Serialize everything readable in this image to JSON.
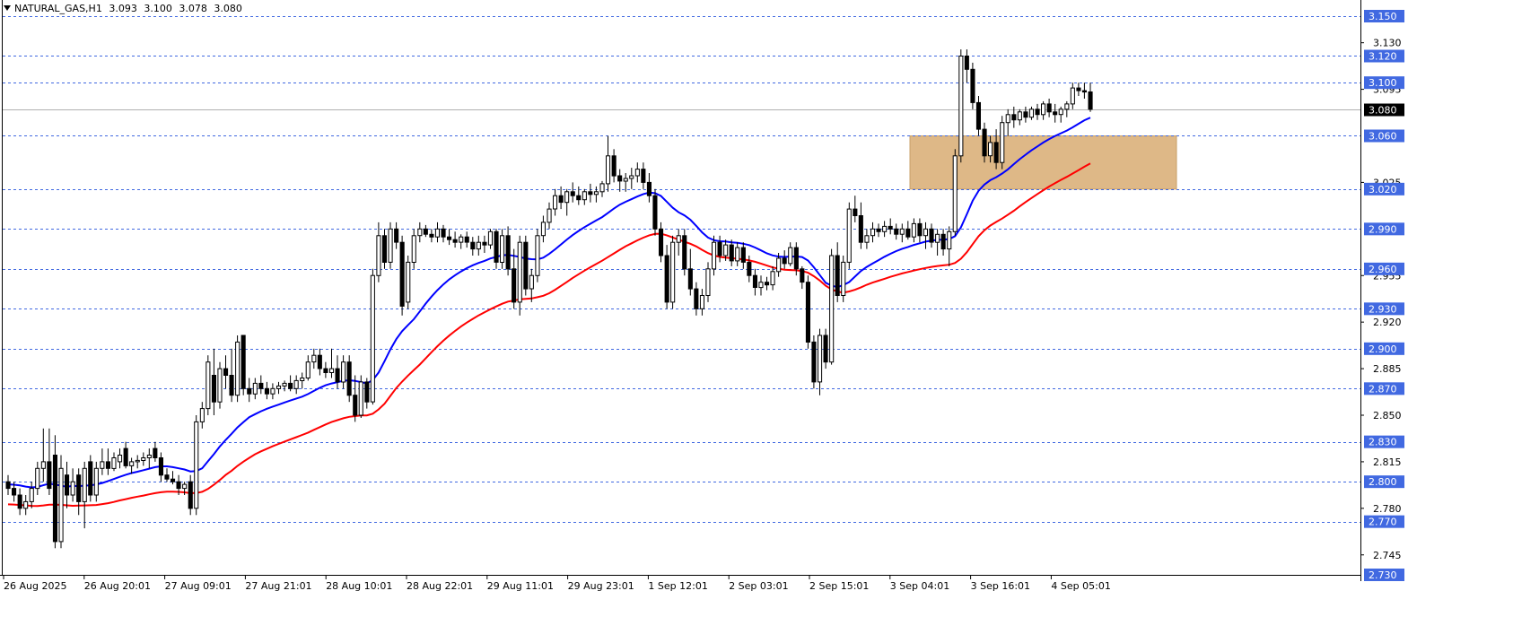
{
  "header": {
    "symbol": "NATURAL_GAS,H1",
    "open": "3.093",
    "high": "3.100",
    "low": "3.078",
    "close": "3.080"
  },
  "chart_data": {
    "type": "candlestick",
    "ylim": [
      2.73,
      3.165
    ],
    "grid": false,
    "price_ticks": [
      "3.130",
      "3.095",
      "3.025",
      "2.955",
      "2.920",
      "2.885",
      "2.850",
      "2.815",
      "2.780",
      "2.745"
    ],
    "level_lines": [
      "3.150",
      "3.120",
      "3.100",
      "3.060",
      "3.020",
      "2.990",
      "2.960",
      "2.930",
      "2.900",
      "2.870",
      "2.830",
      "2.800",
      "2.770",
      "2.730"
    ],
    "current_price": "3.080",
    "time_labels": [
      "26 Aug 2025",
      "26 Aug 20:01",
      "27 Aug 09:01",
      "27 Aug 21:01",
      "28 Aug 10:01",
      "28 Aug 22:01",
      "29 Aug 11:01",
      "29 Aug 23:01",
      "1 Sep 12:01",
      "2 Sep 03:01",
      "2 Sep 15:01",
      "3 Sep 04:01",
      "3 Sep 16:01",
      "4 Sep 05:01"
    ],
    "zone": {
      "top": 3.06,
      "bottom": 3.02,
      "color": "#deb887"
    },
    "colors": {
      "ma_fast": "#0000ff",
      "ma_slow": "#ff0000",
      "bull": "#ffffff",
      "bear": "#000000",
      "level": "#4169e1"
    },
    "ohlc": [
      [
        2.8,
        2.805,
        2.79,
        2.795
      ],
      [
        2.795,
        2.8,
        2.785,
        2.79
      ],
      [
        2.79,
        2.795,
        2.775,
        2.78
      ],
      [
        2.78,
        2.79,
        2.775,
        2.785
      ],
      [
        2.785,
        2.8,
        2.78,
        2.795
      ],
      [
        2.795,
        2.815,
        2.79,
        2.81
      ],
      [
        2.81,
        2.84,
        2.8,
        2.815
      ],
      [
        2.815,
        2.84,
        2.79,
        2.795
      ],
      [
        2.82,
        2.835,
        2.75,
        2.755
      ],
      [
        2.755,
        2.82,
        2.75,
        2.81
      ],
      [
        2.805,
        2.815,
        2.78,
        2.79
      ],
      [
        2.79,
        2.81,
        2.785,
        2.8
      ],
      [
        2.805,
        2.81,
        2.775,
        2.785
      ],
      [
        2.785,
        2.815,
        2.765,
        2.81
      ],
      [
        2.815,
        2.82,
        2.785,
        2.79
      ],
      [
        2.79,
        2.815,
        2.785,
        2.81
      ],
      [
        2.81,
        2.825,
        2.805,
        2.815
      ],
      [
        2.815,
        2.825,
        2.805,
        2.81
      ],
      [
        2.81,
        2.822,
        2.808,
        2.818
      ],
      [
        2.815,
        2.825,
        2.81,
        2.82
      ],
      [
        2.825,
        2.83,
        2.81,
        2.812
      ],
      [
        2.812,
        2.818,
        2.806,
        2.815
      ],
      [
        2.815,
        2.82,
        2.81,
        2.816
      ],
      [
        2.816,
        2.822,
        2.812,
        2.818
      ],
      [
        2.818,
        2.825,
        2.81,
        2.82
      ],
      [
        2.825,
        2.83,
        2.815,
        2.818
      ],
      [
        2.818,
        2.822,
        2.8,
        2.805
      ],
      [
        2.805,
        2.81,
        2.8,
        2.802
      ],
      [
        2.802,
        2.808,
        2.798,
        2.8
      ],
      [
        2.8,
        2.805,
        2.79,
        2.795
      ],
      [
        2.795,
        2.8,
        2.79,
        2.798
      ],
      [
        2.8,
        2.805,
        2.775,
        2.78
      ],
      [
        2.78,
        2.85,
        2.775,
        2.845
      ],
      [
        2.845,
        2.86,
        2.84,
        2.855
      ],
      [
        2.855,
        2.895,
        2.85,
        2.89
      ],
      [
        2.88,
        2.9,
        2.85,
        2.86
      ],
      [
        2.86,
        2.89,
        2.855,
        2.885
      ],
      [
        2.885,
        2.895,
        2.87,
        2.88
      ],
      [
        2.88,
        2.9,
        2.86,
        2.865
      ],
      [
        2.865,
        2.91,
        2.86,
        2.905
      ],
      [
        2.91,
        2.91,
        2.865,
        2.87
      ],
      [
        2.87,
        2.878,
        2.86,
        2.866
      ],
      [
        2.866,
        2.878,
        2.862,
        2.874
      ],
      [
        2.874,
        2.88,
        2.866,
        2.87
      ],
      [
        2.87,
        2.875,
        2.862,
        2.866
      ],
      [
        2.866,
        2.874,
        2.862,
        2.87
      ],
      [
        2.87,
        2.875,
        2.866,
        2.872
      ],
      [
        2.872,
        2.876,
        2.868,
        2.874
      ],
      [
        2.874,
        2.88,
        2.868,
        2.87
      ],
      [
        2.87,
        2.88,
        2.866,
        2.876
      ],
      [
        2.876,
        2.882,
        2.87,
        2.878
      ],
      [
        2.878,
        2.895,
        2.876,
        2.89
      ],
      [
        2.89,
        2.9,
        2.885,
        2.895
      ],
      [
        2.895,
        2.9,
        2.88,
        2.885
      ],
      [
        2.885,
        2.89,
        2.878,
        2.882
      ],
      [
        2.882,
        2.9,
        2.878,
        2.885
      ],
      [
        2.885,
        2.895,
        2.87,
        2.875
      ],
      [
        2.875,
        2.895,
        2.87,
        2.89
      ],
      [
        2.89,
        2.895,
        2.86,
        2.865
      ],
      [
        2.865,
        2.88,
        2.845,
        2.85
      ],
      [
        2.85,
        2.88,
        2.848,
        2.875
      ],
      [
        2.875,
        2.878,
        2.855,
        2.86
      ],
      [
        2.86,
        2.96,
        2.858,
        2.955
      ],
      [
        2.955,
        2.995,
        2.95,
        2.985
      ],
      [
        2.985,
        2.99,
        2.96,
        2.965
      ],
      [
        2.965,
        2.995,
        2.96,
        2.99
      ],
      [
        2.99,
        2.995,
        2.975,
        2.98
      ],
      [
        2.98,
        2.985,
        2.925,
        2.932
      ],
      [
        2.935,
        2.97,
        2.93,
        2.965
      ],
      [
        2.965,
        2.99,
        2.96,
        2.985
      ],
      [
        2.985,
        2.995,
        2.98,
        2.99
      ],
      [
        2.99,
        2.993,
        2.984,
        2.986
      ],
      [
        2.986,
        2.99,
        2.98,
        2.984
      ],
      [
        2.984,
        2.995,
        2.98,
        2.99
      ],
      [
        2.99,
        2.993,
        2.98,
        2.984
      ],
      [
        2.984,
        2.99,
        2.978,
        2.982
      ],
      [
        2.982,
        2.988,
        2.976,
        2.98
      ],
      [
        2.98,
        2.986,
        2.975,
        2.984
      ],
      [
        2.984,
        2.988,
        2.976,
        2.98
      ],
      [
        2.98,
        2.984,
        2.97,
        2.975
      ],
      [
        2.975,
        2.985,
        2.97,
        2.98
      ],
      [
        2.98,
        2.985,
        2.972,
        2.978
      ],
      [
        2.978,
        2.99,
        2.975,
        2.988
      ],
      [
        2.988,
        2.99,
        2.96,
        2.965
      ],
      [
        2.965,
        2.99,
        2.96,
        2.985
      ],
      [
        2.985,
        2.992,
        2.955,
        2.96
      ],
      [
        2.96,
        2.975,
        2.93,
        2.935
      ],
      [
        2.935,
        2.985,
        2.925,
        2.98
      ],
      [
        2.98,
        2.985,
        2.94,
        2.945
      ],
      [
        2.945,
        2.96,
        2.935,
        2.955
      ],
      [
        2.955,
        2.99,
        2.95,
        2.985
      ],
      [
        2.985,
        3.0,
        2.98,
        2.995
      ],
      [
        2.995,
        3.01,
        2.99,
        3.005
      ],
      [
        3.005,
        3.02,
        3.0,
        3.015
      ],
      [
        3.015,
        3.022,
        3.005,
        3.01
      ],
      [
        3.01,
        3.02,
        3.0,
        3.018
      ],
      [
        3.018,
        3.025,
        3.01,
        3.015
      ],
      [
        3.015,
        3.022,
        3.008,
        3.012
      ],
      [
        3.012,
        3.02,
        3.008,
        3.018
      ],
      [
        3.018,
        3.024,
        3.01,
        3.016
      ],
      [
        3.016,
        3.022,
        3.01,
        3.018
      ],
      [
        3.018,
        3.026,
        3.014,
        3.024
      ],
      [
        3.024,
        3.06,
        3.018,
        3.045
      ],
      [
        3.045,
        3.05,
        3.025,
        3.03
      ],
      [
        3.03,
        3.035,
        3.018,
        3.026
      ],
      [
        3.026,
        3.032,
        3.018,
        3.028
      ],
      [
        3.028,
        3.036,
        3.02,
        3.03
      ],
      [
        3.03,
        3.04,
        3.025,
        3.035
      ],
      [
        3.035,
        3.04,
        3.02,
        3.025
      ],
      [
        3.025,
        3.032,
        3.01,
        3.015
      ],
      [
        3.015,
        3.02,
        2.985,
        2.99
      ],
      [
        2.99,
        2.995,
        2.965,
        2.97
      ],
      [
        2.97,
        2.978,
        2.93,
        2.935
      ],
      [
        2.935,
        2.985,
        2.93,
        2.98
      ],
      [
        2.98,
        2.99,
        2.97,
        2.985
      ],
      [
        2.985,
        2.99,
        2.955,
        2.96
      ],
      [
        2.96,
        2.975,
        2.94,
        2.945
      ],
      [
        2.945,
        2.95,
        2.925,
        2.93
      ],
      [
        2.93,
        2.945,
        2.925,
        2.94
      ],
      [
        2.94,
        2.965,
        2.935,
        2.96
      ],
      [
        2.96,
        2.985,
        2.955,
        2.98
      ],
      [
        2.98,
        2.985,
        2.965,
        2.97
      ],
      [
        2.97,
        2.982,
        2.966,
        2.978
      ],
      [
        2.978,
        2.982,
        2.962,
        2.966
      ],
      [
        2.966,
        2.98,
        2.962,
        2.976
      ],
      [
        2.976,
        2.98,
        2.96,
        2.965
      ],
      [
        2.965,
        2.97,
        2.95,
        2.955
      ],
      [
        2.955,
        2.96,
        2.94,
        2.946
      ],
      [
        2.946,
        2.955,
        2.94,
        2.95
      ],
      [
        2.95,
        2.954,
        2.944,
        2.948
      ],
      [
        2.948,
        2.962,
        2.944,
        2.958
      ],
      [
        2.958,
        2.972,
        2.954,
        2.968
      ],
      [
        2.968,
        2.974,
        2.96,
        2.964
      ],
      [
        2.964,
        2.98,
        2.962,
        2.976
      ],
      [
        2.976,
        2.98,
        2.955,
        2.96
      ],
      [
        2.96,
        2.962,
        2.945,
        2.95
      ],
      [
        2.95,
        2.955,
        2.9,
        2.905
      ],
      [
        2.905,
        2.91,
        2.87,
        2.875
      ],
      [
        2.875,
        2.915,
        2.865,
        2.91
      ],
      [
        2.91,
        2.915,
        2.885,
        2.89
      ],
      [
        2.89,
        2.975,
        2.888,
        2.97
      ],
      [
        2.97,
        2.98,
        2.935,
        2.94
      ],
      [
        2.94,
        2.97,
        2.935,
        2.965
      ],
      [
        2.965,
        3.01,
        2.96,
        3.005
      ],
      [
        3.005,
        3.015,
        2.995,
        3.0
      ],
      [
        3.0,
        3.01,
        2.975,
        2.98
      ],
      [
        2.98,
        2.99,
        2.975,
        2.985
      ],
      [
        2.985,
        2.995,
        2.98,
        2.99
      ],
      [
        2.99,
        2.994,
        2.984,
        2.988
      ],
      [
        2.988,
        2.996,
        2.984,
        2.992
      ],
      [
        2.992,
        2.998,
        2.986,
        2.99
      ],
      [
        2.99,
        2.994,
        2.982,
        2.986
      ],
      [
        2.986,
        2.994,
        2.98,
        2.99
      ],
      [
        2.99,
        2.996,
        2.982,
        2.984
      ],
      [
        2.984,
        2.998,
        2.98,
        2.994
      ],
      [
        2.994,
        2.998,
        2.98,
        2.985
      ],
      [
        2.985,
        2.995,
        2.975,
        2.99
      ],
      [
        2.99,
        2.994,
        2.976,
        2.98
      ],
      [
        2.98,
        2.99,
        2.97,
        2.986
      ],
      [
        2.986,
        2.99,
        2.97,
        2.975
      ],
      [
        2.975,
        2.992,
        2.962,
        2.988
      ],
      [
        2.988,
        3.05,
        2.985,
        3.045
      ],
      [
        3.045,
        3.125,
        3.04,
        3.12
      ],
      [
        3.12,
        3.125,
        3.1,
        3.11
      ],
      [
        3.11,
        3.115,
        3.08,
        3.085
      ],
      [
        3.085,
        3.09,
        3.06,
        3.065
      ],
      [
        3.065,
        3.07,
        3.04,
        3.045
      ],
      [
        3.045,
        3.06,
        3.04,
        3.055
      ],
      [
        3.055,
        3.065,
        3.035,
        3.04
      ],
      [
        3.04,
        3.075,
        3.035,
        3.07
      ],
      [
        3.07,
        3.08,
        3.06,
        3.076
      ],
      [
        3.076,
        3.082,
        3.066,
        3.072
      ],
      [
        3.072,
        3.08,
        3.068,
        3.078
      ],
      [
        3.078,
        3.082,
        3.07,
        3.074
      ],
      [
        3.074,
        3.082,
        3.072,
        3.08
      ],
      [
        3.08,
        3.084,
        3.072,
        3.076
      ],
      [
        3.076,
        3.086,
        3.072,
        3.084
      ],
      [
        3.084,
        3.088,
        3.074,
        3.078
      ],
      [
        3.078,
        3.084,
        3.07,
        3.076
      ],
      [
        3.076,
        3.082,
        3.07,
        3.08
      ],
      [
        3.08,
        3.086,
        3.074,
        3.084
      ],
      [
        3.084,
        3.1,
        3.08,
        3.096
      ],
      [
        3.096,
        3.1,
        3.09,
        3.094
      ],
      [
        3.094,
        3.1,
        3.088,
        3.093
      ],
      [
        3.093,
        3.1,
        3.078,
        3.08
      ]
    ]
  }
}
